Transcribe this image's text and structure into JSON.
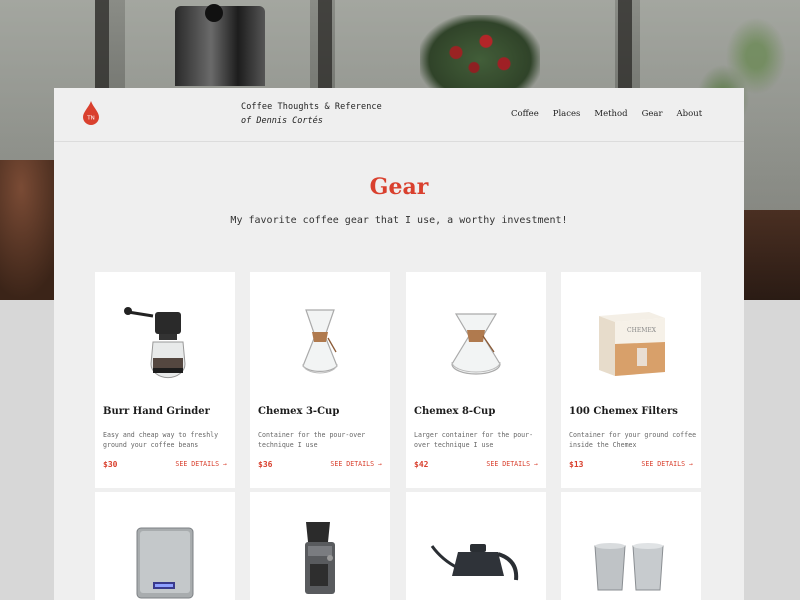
{
  "brand": {
    "logo_letters": "TN",
    "title": "Coffee Thoughts & Reference",
    "subtitle": "of Dennis Cortés"
  },
  "nav": [
    "Coffee",
    "Places",
    "Method",
    "Gear",
    "About"
  ],
  "page": {
    "title": "Gear",
    "subtitle": "My favorite coffee gear that I use, a worthy investment!"
  },
  "details_label": "SEE DETAILS →",
  "products": [
    {
      "name": "Burr Hand Grinder",
      "desc": "Easy and cheap way to freshly ground your coffee beans",
      "price": "$30",
      "icon": "hand-grinder-icon"
    },
    {
      "name": "Chemex 3-Cup",
      "desc": "Container for the pour-over technique I use",
      "price": "$36",
      "icon": "chemex-small-icon"
    },
    {
      "name": "Chemex 8-Cup",
      "desc": "Larger container for the pour-over technique I use",
      "price": "$42",
      "icon": "chemex-large-icon"
    },
    {
      "name": "100 Chemex Filters",
      "desc": "Container for your ground coffee inside the Chemex",
      "price": "$13",
      "icon": "filter-box-icon"
    },
    {
      "icon": "kitchen-scale-icon"
    },
    {
      "icon": "electric-grinder-icon"
    },
    {
      "icon": "gooseneck-kettle-icon"
    },
    {
      "icon": "steel-cups-icon"
    }
  ],
  "colors": {
    "accent": "#d9402e",
    "panel": "#efefef",
    "card": "#ffffff"
  }
}
